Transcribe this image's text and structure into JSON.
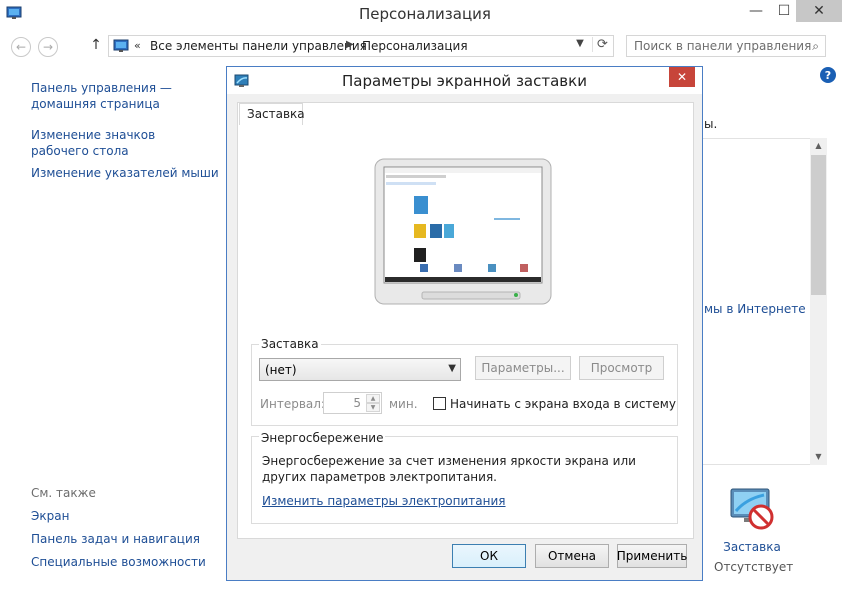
{
  "window": {
    "title": "Персонализация",
    "controls": {
      "minimize": "—",
      "maximize": "☐",
      "close": "✕"
    }
  },
  "address": {
    "crumb_root": "Все элементы панели управления",
    "crumb_current": "Персонализация",
    "chevrons": "«",
    "separator": "▶",
    "search_placeholder": "Поиск в панели управления"
  },
  "left_nav": {
    "home": "Панель управления — домашняя страница",
    "desktop_icons": "Изменение значков рабочего стола",
    "mouse_pointers": "Изменение указателей мыши",
    "see_also_heading": "См. также",
    "see_also": [
      "Экран",
      "Панель задач и навигация",
      "Специальные возможности"
    ]
  },
  "main": {
    "fragment_text": "ы.",
    "online_themes_link": "мы в Интернете",
    "saver_tile_label": "Заставка",
    "saver_tile_state": "Отсутствует"
  },
  "dialog": {
    "title": "Параметры экранной заставки",
    "close": "✕",
    "tab": "Заставка",
    "screensaver_group": "Заставка",
    "screensaver_value": "(нет)",
    "settings_button": "Параметры...",
    "preview_button": "Просмотр",
    "interval_label": "Интервал:",
    "interval_value": "5",
    "interval_unit": "мин.",
    "logon_checkbox_label": "Начинать с экрана входа в систему",
    "logon_checkbox_checked": false,
    "power_group": "Энергосбережение",
    "power_text": "Энергосбережение за счет изменения яркости экрана или других параметров электропитания.",
    "power_link": "Изменить параметры электропитания",
    "ok": "ОК",
    "cancel": "Отмена",
    "apply": "Применить"
  },
  "colors": {
    "link": "#1e4e95",
    "dialog_border": "#4a7dc4",
    "close_red": "#c7453a"
  }
}
